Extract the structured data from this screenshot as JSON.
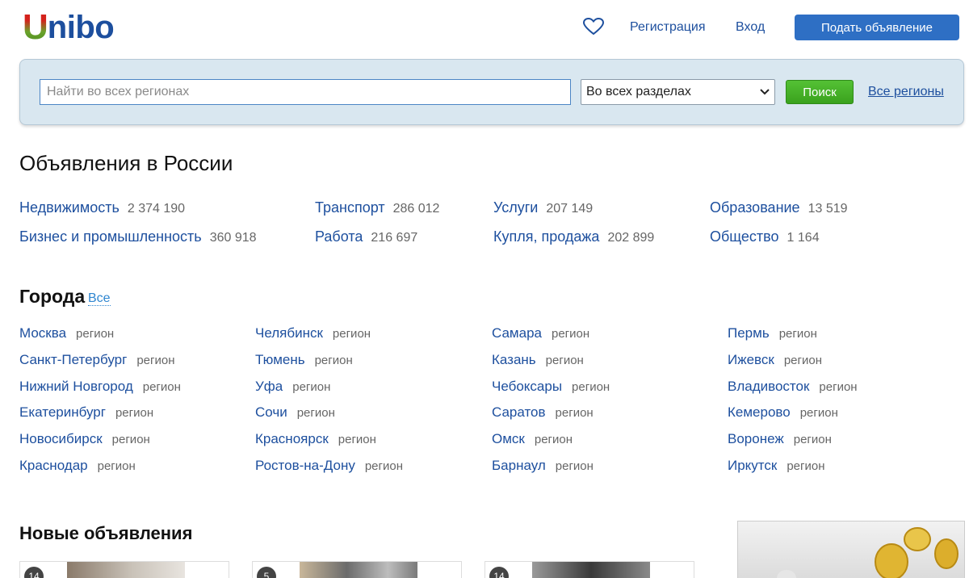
{
  "header": {
    "logo_first_letter": "U",
    "logo_rest": "nibo",
    "favorites_icon": "heart-icon",
    "register": "Регистрация",
    "login": "Вход",
    "post_ad": "Подать объявление"
  },
  "search": {
    "placeholder": "Найти во всех регионах",
    "value": "",
    "section": "Во всех разделах",
    "button": "Поиск",
    "regions_link": "Все регионы"
  },
  "categories_title": "Объявления в России",
  "categories": [
    {
      "name": "Недвижимость",
      "count": "2 374 190"
    },
    {
      "name": "Бизнес и промышленность",
      "count": "360 918"
    },
    {
      "name": "Транспорт",
      "count": "286 012"
    },
    {
      "name": "Работа",
      "count": "216 697"
    },
    {
      "name": "Услуги",
      "count": "207 149"
    },
    {
      "name": "Купля, продажа",
      "count": "202 899"
    },
    {
      "name": "Образование",
      "count": "13 519"
    },
    {
      "name": "Общество",
      "count": "1 164"
    }
  ],
  "cities_title": "Города",
  "cities_all": "Все",
  "region_label": "регион",
  "cities": [
    "Москва",
    "Санкт-Петербург",
    "Нижний Новгород",
    "Екатеринбург",
    "Новосибирск",
    "Краснодар",
    "Челябинск",
    "Тюмень",
    "Уфа",
    "Сочи",
    "Красноярск",
    "Ростов-на-Дону",
    "Самара",
    "Казань",
    "Чебоксары",
    "Саратов",
    "Омск",
    "Барнаул",
    "Пермь",
    "Ижевск",
    "Владивосток",
    "Кемерово",
    "Воронеж",
    "Иркутск"
  ],
  "new_ads_title": "Новые объявления",
  "new_ads": [
    {
      "photo_count": "14"
    },
    {
      "photo_count": "5"
    },
    {
      "photo_count": "14"
    }
  ],
  "colors": {
    "link": "#1d4f9e",
    "post_button": "#2e6fc4",
    "search_button": "#3aa21d",
    "search_panel": "#d9e7f0"
  }
}
